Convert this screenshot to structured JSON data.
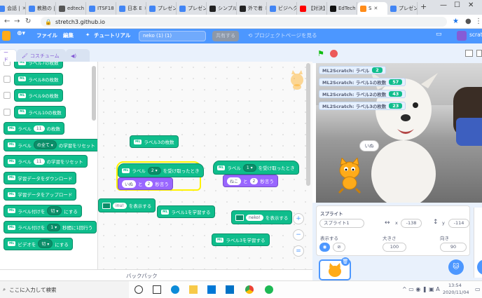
{
  "browser": {
    "tabs": [
      {
        "label": "会話 |",
        "fav": "#4285f4"
      },
      {
        "label": "教務の |",
        "fav": "#4285f4"
      },
      {
        "label": "edtech",
        "fav": "#555"
      },
      {
        "label": "ITSF18",
        "fav": "#4285f4"
      },
      {
        "label": "日本 E",
        "fav": "#4285f4"
      },
      {
        "label": "プレゼン",
        "fav": "#4285f4"
      },
      {
        "label": "プレゼン",
        "fav": "#4285f4"
      },
      {
        "label": "シンプル",
        "fav": "#222"
      },
      {
        "label": "外で着",
        "fav": "#222"
      },
      {
        "label": "ビジヘク",
        "fav": "#4285f4"
      },
      {
        "label": "【対決】",
        "fav": "#ff0000"
      },
      {
        "label": "EdTech",
        "fav": "#111"
      },
      {
        "label": "S",
        "fav": "#ff8c1a",
        "active": true
      },
      {
        "label": "プレゼン",
        "fav": "#4285f4"
      }
    ],
    "new_tab": "+",
    "url": "stretch3.github.io"
  },
  "menu": {
    "file": "ファイル",
    "edit": "編集",
    "tutorial": "チュートリアル",
    "project_title": "neko (1) (1)",
    "share": "共有する",
    "see_project": "プロジェクトページを見る",
    "user": "scratch"
  },
  "editor_tabs": {
    "code": "ード",
    "costumes": "コスチューム",
    "sounds": "音"
  },
  "palette": [
    {
      "text": "ラベル7の枚数",
      "check": true
    },
    {
      "text": "ラベル8の枚数",
      "check": true
    },
    {
      "text": "ラベル9の枚数",
      "check": true
    },
    {
      "text": "ラベル10の枚数",
      "check": true
    },
    {
      "pre": "ラベル",
      "val": "11",
      "post": "の枚数"
    },
    {
      "pre": "ラベル",
      "dd": "の全て",
      "post": "の学習をリセット"
    },
    {
      "pre": "ラベル",
      "val": "11",
      "post": "の学習をリセット"
    },
    {
      "text": "学習データをダウンロード"
    },
    {
      "text": "学習データをアップロード"
    },
    {
      "pre": "ラベル付けを",
      "dd": "切",
      "post": "にする"
    },
    {
      "pre": "ラベル付けを",
      "dd": "1",
      "post": "秒間に1回行う"
    },
    {
      "pre": "ビデオを",
      "dd": "切",
      "post": "にする"
    }
  ],
  "scripts": {
    "b1": {
      "text": "ラベル3の枚数"
    },
    "b2": {
      "pre": "ラベル",
      "dd": "2",
      "post": "を受け取ったとき"
    },
    "b3": {
      "val": "いぬ",
      "mid": "と",
      "val2": "2",
      "post": "秒言う"
    },
    "b4": {
      "pre": "ラベル",
      "dd": "1",
      "post": "を受け取ったとき"
    },
    "b5": {
      "val": "ねこ",
      "mid": "と",
      "val2": "2",
      "post": "秒言う"
    },
    "b6": {
      "val": "inu!",
      "post": "を表示する"
    },
    "b7": {
      "text": "ラベル1を学習する"
    },
    "b8": {
      "val": "neko!",
      "post": "を表示する"
    },
    "b9": {
      "text": "ラベル3を学習する"
    }
  },
  "zoom": {
    "in": "+",
    "out": "−",
    "reset": "="
  },
  "backpack": "バックパック",
  "monitors": [
    {
      "label": "ML2Scratch: ラベル",
      "value": "2"
    },
    {
      "label": "ML2Scratch: ラベル1の枚数",
      "value": "57"
    },
    {
      "label": "ML2Scratch: ラベル2の枚数",
      "value": "43"
    },
    {
      "label": "ML2Scratch: ラベル3の枚数",
      "value": "23"
    }
  ],
  "speech": "いぬ",
  "sprite": {
    "title": "スプライト",
    "name": "スプライト1",
    "x_label": "x",
    "x": "-138",
    "y_label": "y",
    "y": "-114",
    "show_label": "表示する",
    "size_label": "大きさ",
    "size": "100",
    "dir_label": "向き",
    "dir": "90"
  },
  "taskbar": {
    "search": "ここに入力して検索",
    "time": "13:54",
    "date": "2020/11/04"
  },
  "colors": {
    "scratch_blue": "#4c97ff",
    "ml_green": "#0fbd8c",
    "highlight": "#fff200",
    "purple": "#9966ff"
  }
}
